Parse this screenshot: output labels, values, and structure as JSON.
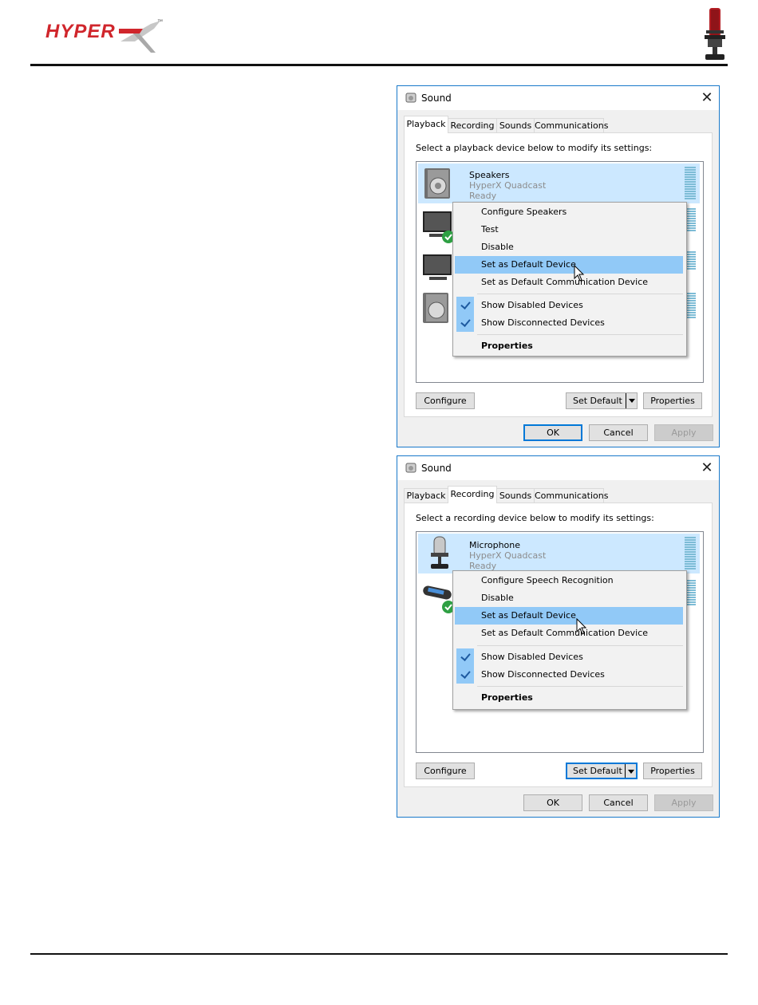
{
  "brand": {
    "logo_text": "HYPER",
    "logo_tm": "™"
  },
  "window1": {
    "title": "Sound",
    "tabs": [
      "Playback",
      "Recording",
      "Sounds",
      "Communications"
    ],
    "active_tab": "Playback",
    "prompt": "Select a playback device below to modify its settings:",
    "device": {
      "name": "Speakers",
      "model": "HyperX Quadcast",
      "status": "Ready"
    },
    "menu": {
      "items": [
        "Configure Speakers",
        "Test",
        "Disable",
        "Set as Default Device",
        "Set as Default Communication Device"
      ],
      "highlighted": "Set as Default Device",
      "checked": [
        "Show Disabled Devices",
        "Show Disconnected Devices"
      ],
      "properties": "Properties"
    },
    "buttons": {
      "configure": "Configure",
      "set_default": "Set Default",
      "properties": "Properties",
      "ok": "OK",
      "cancel": "Cancel",
      "apply": "Apply"
    }
  },
  "window2": {
    "title": "Sound",
    "tabs": [
      "Playback",
      "Recording",
      "Sounds",
      "Communications"
    ],
    "active_tab": "Recording",
    "prompt": "Select a recording device below to modify its settings:",
    "device": {
      "name": "Microphone",
      "model": "HyperX Quadcast",
      "status": "Ready"
    },
    "menu": {
      "items": [
        "Configure Speech Recognition",
        "Disable",
        "Set as Default Device",
        "Set as Default Communication Device"
      ],
      "highlighted": "Set as Default Device",
      "checked": [
        "Show Disabled Devices",
        "Show Disconnected Devices"
      ],
      "properties": "Properties"
    },
    "buttons": {
      "configure": "Configure",
      "set_default": "Set Default",
      "properties": "Properties",
      "ok": "OK",
      "cancel": "Cancel",
      "apply": "Apply"
    }
  },
  "colors": {
    "brand_red": "#d0262c",
    "selection": "#cce8ff",
    "menu_highlight": "#91c9f7",
    "window_border": "#1979ca"
  }
}
